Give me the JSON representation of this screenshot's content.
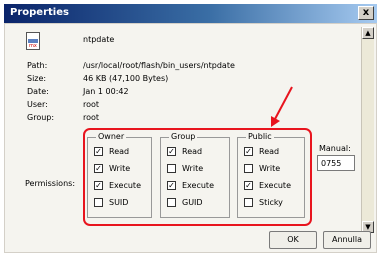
{
  "window": {
    "title": "Properties",
    "close_label": "x"
  },
  "file": {
    "icon_text": "mx",
    "name": "ntpdate",
    "fields": [
      {
        "label": "Path:",
        "value": "/usr/local/root/flash/bin_users/ntpdate"
      },
      {
        "label": "Size:",
        "value": "46 KB (47,100 Bytes)"
      },
      {
        "label": "Date:",
        "value": "Jan 1 00:42"
      },
      {
        "label": "User:",
        "value": "root"
      },
      {
        "label": "Group:",
        "value": "root"
      }
    ]
  },
  "permissions": {
    "label": "Permissions:",
    "groups": [
      {
        "title": "Owner",
        "items": [
          {
            "label": "Read",
            "checked": true,
            "mark": "✓"
          },
          {
            "label": "Write",
            "checked": true,
            "mark": "✓"
          },
          {
            "label": "Execute",
            "checked": true,
            "mark": "✓"
          },
          {
            "label": "SUID",
            "checked": false,
            "mark": ""
          }
        ]
      },
      {
        "title": "Group",
        "items": [
          {
            "label": "Read",
            "checked": true,
            "mark": "✓"
          },
          {
            "label": "Write",
            "checked": false,
            "mark": ""
          },
          {
            "label": "Execute",
            "checked": true,
            "mark": "✓"
          },
          {
            "label": "GUID",
            "checked": false,
            "mark": ""
          }
        ]
      },
      {
        "title": "Public",
        "items": [
          {
            "label": "Read",
            "checked": true,
            "mark": "✓"
          },
          {
            "label": "Write",
            "checked": false,
            "mark": ""
          },
          {
            "label": "Execute",
            "checked": true,
            "mark": "✓"
          },
          {
            "label": "Sticky",
            "checked": false,
            "mark": ""
          }
        ]
      }
    ]
  },
  "manual": {
    "label": "Manual:",
    "value": "0755"
  },
  "buttons": {
    "ok": "OK",
    "cancel": "Annulla"
  },
  "colors": {
    "highlight": "#e8141e",
    "title_start": "#0a246a",
    "title_end": "#a6caf0"
  }
}
